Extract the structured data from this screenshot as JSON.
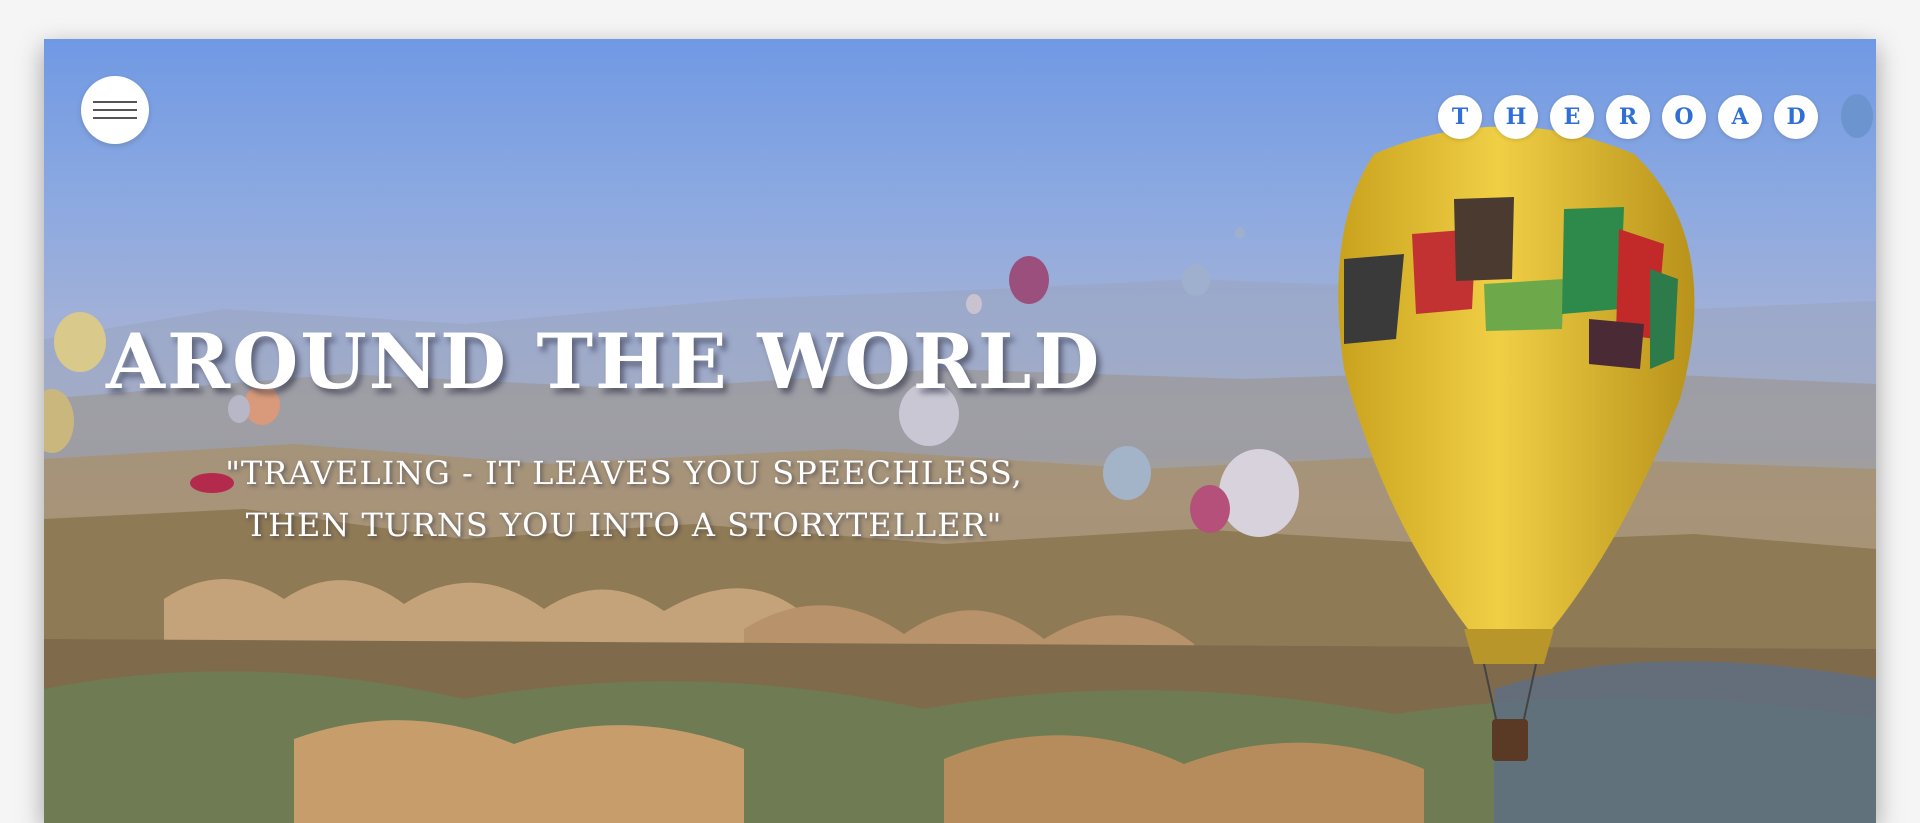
{
  "menu": {
    "label": "Menu",
    "icon": "hamburger-icon"
  },
  "brand": {
    "letters": [
      "T",
      "H",
      "E",
      "R",
      "O",
      "A",
      "D"
    ],
    "color": "#2f6fd6"
  },
  "hero": {
    "headline": "AROUND THE WORLD",
    "quote_line1": "\"TRAVELING - IT LEAVES YOU SPEECHLESS,",
    "quote_line2": "THEN TURNS YOU INTO A STORYTELLER\""
  },
  "colors": {
    "sky": "#7099e4",
    "balloon": "#e3c23a",
    "text": "#ffffff"
  }
}
